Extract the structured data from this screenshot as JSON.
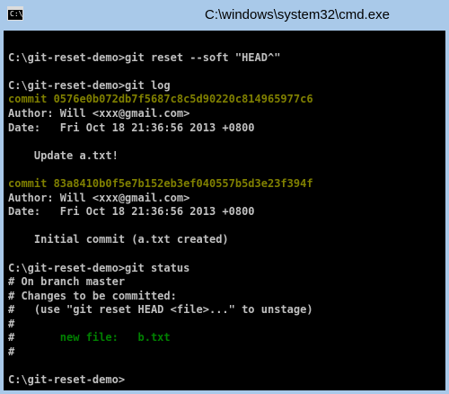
{
  "window": {
    "title": "C:\\windows\\system32\\cmd.exe",
    "icon_text": "C:\\"
  },
  "console": {
    "lines": [
      {
        "text": "",
        "color": "default"
      },
      {
        "text": "C:\\git-reset-demo>git reset --soft \"HEAD^\"",
        "color": "default"
      },
      {
        "text": "",
        "color": "default"
      },
      {
        "text": "C:\\git-reset-demo>git log",
        "color": "default"
      },
      {
        "text": "commit 0576e0b072db7f5687c8c5d90220c814965977c6",
        "color": "yellow"
      },
      {
        "text": "Author: Will <xxx@gmail.com>",
        "color": "default"
      },
      {
        "text": "Date:   Fri Oct 18 21:36:56 2013 +0800",
        "color": "default"
      },
      {
        "text": "",
        "color": "default"
      },
      {
        "text": "    Update a.txt!",
        "color": "default"
      },
      {
        "text": "",
        "color": "default"
      },
      {
        "text": "commit 83a8410b0f5e7b152eb3ef040557b5d3e23f394f",
        "color": "yellow"
      },
      {
        "text": "Author: Will <xxx@gmail.com>",
        "color": "default"
      },
      {
        "text": "Date:   Fri Oct 18 21:36:56 2013 +0800",
        "color": "default"
      },
      {
        "text": "",
        "color": "default"
      },
      {
        "text": "    Initial commit (a.txt created)",
        "color": "default"
      },
      {
        "text": "",
        "color": "default"
      },
      {
        "text": "C:\\git-reset-demo>git status",
        "color": "default"
      },
      {
        "text": "# On branch master",
        "color": "default"
      },
      {
        "text": "# Changes to be committed:",
        "color": "default"
      },
      {
        "text": "#   (use \"git reset HEAD <file>...\" to unstage)",
        "color": "default"
      },
      {
        "text": "#",
        "color": "default"
      },
      {
        "text": "#",
        "color": "default",
        "green_suffix": "       new file:   b.txt"
      },
      {
        "text": "#",
        "color": "default"
      },
      {
        "text": "",
        "color": "default"
      },
      {
        "text": "C:\\git-reset-demo>",
        "color": "default"
      }
    ]
  }
}
